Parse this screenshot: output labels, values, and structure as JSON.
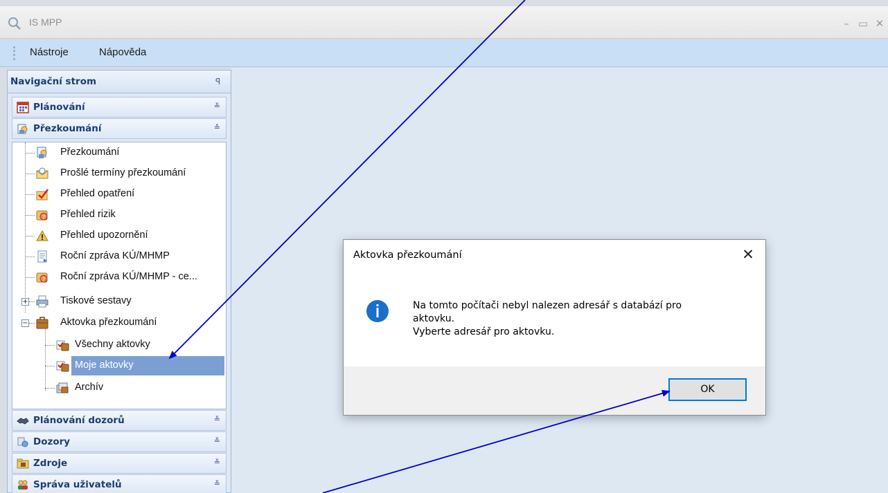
{
  "window": {
    "title": "IS MPP",
    "minimize_icon": "minimize-icon",
    "maximize_icon": "maximize-icon",
    "close_icon": "close-icon"
  },
  "menu": {
    "items": [
      "Nástroje",
      "Nápověda"
    ]
  },
  "nav": {
    "header": "Navigační strom",
    "groups": [
      {
        "label": "Plánování",
        "icon": "calendar-icon",
        "state": "collapsed"
      },
      {
        "label": "Přezkoumání",
        "icon": "review-icon",
        "state": "expanded"
      },
      {
        "label": "Plánování dozorů",
        "icon": "handshake-icon",
        "state": "collapsed"
      },
      {
        "label": "Dozory",
        "icon": "supervision-icon",
        "state": "collapsed"
      },
      {
        "label": "Zdroje",
        "icon": "folder-icon",
        "state": "collapsed"
      },
      {
        "label": "Správa uživatelů",
        "icon": "users-icon",
        "state": "collapsed"
      }
    ],
    "tree": [
      {
        "label": "Přezkoumání",
        "icon": "review-icon"
      },
      {
        "label": "Prošlé termíny přezkoumání",
        "icon": "envelope-icon"
      },
      {
        "label": "Přehled opatření",
        "icon": "checkbox-icon"
      },
      {
        "label": "Přehled rizik",
        "icon": "risk-icon"
      },
      {
        "label": "Přehled upozornění",
        "icon": "warning-icon"
      },
      {
        "label": "Roční zpráva KÚ/MHMP",
        "icon": "report-icon"
      },
      {
        "label": "Roční zpráva KÚ/MHMP - ce...",
        "icon": "risk-icon"
      },
      {
        "label": "Tiskové sestavy",
        "icon": "printer-icon"
      },
      {
        "label": "Aktovka přezkoumání",
        "icon": "briefcase-icon"
      },
      {
        "label": "Všechny aktovky",
        "icon": "briefcase-check-icon"
      },
      {
        "label": "Moje aktovky",
        "icon": "briefcase-check-icon",
        "selected": true
      },
      {
        "label": "Archív",
        "icon": "archive-icon"
      }
    ]
  },
  "dialog": {
    "title": "Aktovka přezkoumání",
    "message_lines": [
      "Na tomto počítači nebyl nalezen adresář s databází pro",
      "aktovku.",
      "Vyberte adresář pro aktovku."
    ],
    "ok_label": "OK"
  },
  "colors": {
    "accent": "#0078d7",
    "arrow": "#0000cc",
    "selection": "#7c9fd3",
    "nav_text": "#1c3d72"
  }
}
